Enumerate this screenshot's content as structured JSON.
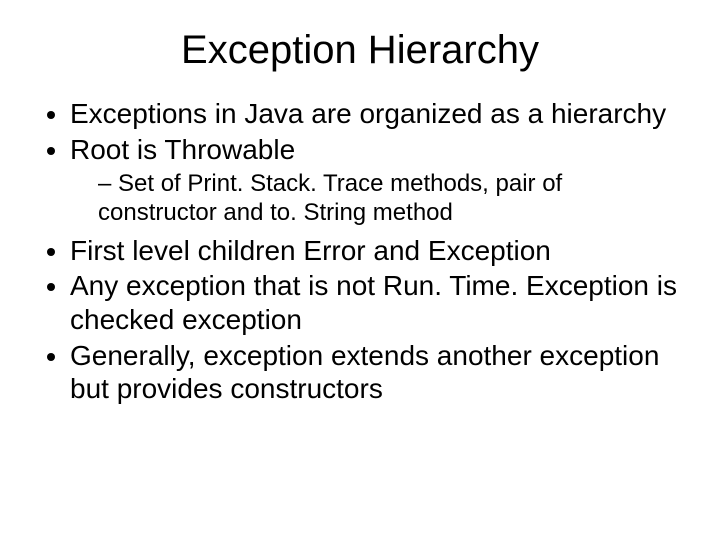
{
  "title": "Exception Hierarchy",
  "bullets": {
    "b1": "Exceptions in Java are organized as a hierarchy",
    "b2": "Root is Throwable",
    "b2_sub1": "Set of Print. Stack. Trace methods, pair of constructor and to. String method",
    "b3": "First level children Error and Exception",
    "b4": "Any exception that is not Run. Time. Exception is checked exception",
    "b5": "Generally, exception extends another exception but provides constructors"
  }
}
